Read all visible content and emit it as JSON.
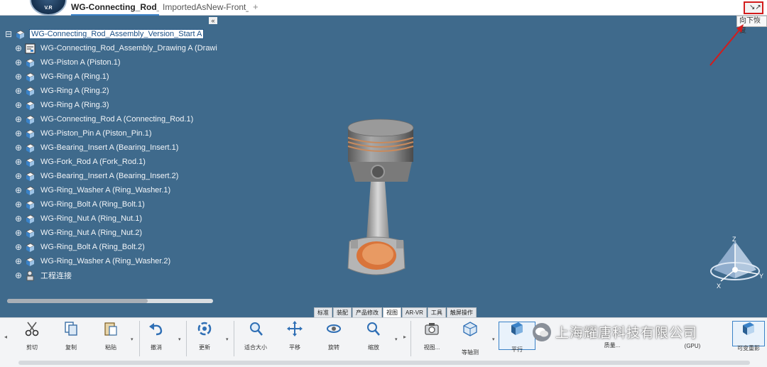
{
  "topbar": {
    "logo_text": "V.R",
    "active_tab": "WG-Connecting_Rod_As",
    "inactive_tab": "ImportedAsNew-Front_L",
    "plus": "+",
    "restore_glyph": "↘↗"
  },
  "tooltip": "向下恢复",
  "collapse": "«",
  "tree": {
    "root": "WG-Connecting_Rod_Assembly_Version_Start A",
    "items": [
      "WG-Connecting_Rod_Assembly_Drawing A (Drawing_l",
      "WG-Piston A (Piston.1)",
      "WG-Ring A (Ring.1)",
      "WG-Ring A (Ring.2)",
      "WG-Ring A (Ring.3)",
      "WG-Connecting_Rod A (Connecting_Rod.1)",
      "WG-Piston_Pin A (Piston_Pin.1)",
      "WG-Bearing_Insert A (Bearing_Insert.1)",
      "WG-Fork_Rod A (Fork_Rod.1)",
      "WG-Bearing_Insert A (Bearing_Insert.2)",
      "WG-Ring_Washer A (Ring_Washer.1)",
      "WG-Ring_Bolt A (Ring_Bolt.1)",
      "WG-Ring_Nut A (Ring_Nut.1)",
      "WG-Ring_Nut A (Ring_Nut.2)",
      "WG-Ring_Bolt A (Ring_Bolt.2)",
      "WG-Ring_Washer A (Ring_Washer.2)",
      "工程连接"
    ]
  },
  "ribbon": {
    "tabs": [
      "标准",
      "装配",
      "产品修改",
      "视图",
      "AR-VR",
      "工具",
      "触屏操作"
    ],
    "active_tab": "视图",
    "tools": {
      "cut": "剪切",
      "copy": "复制",
      "paste": "粘贴",
      "undo": "撤消",
      "update": "更新",
      "fit": "适合大小",
      "pan": "平移",
      "rotate": "旋转",
      "zoom": "缩放",
      "view": "视图...",
      "isometric": "等轴测",
      "parallel": "平行",
      "quality": "质量...",
      "gpu_line1": "(GPU)",
      "visibility": "可变重影"
    }
  },
  "watermark": "上海耀唐科技有限公司",
  "navcube": {
    "z": "Z",
    "x": "X",
    "y": "Y"
  },
  "colors": {
    "viewport_bg": "#3f6a8c",
    "accent": "#3a82c8",
    "highlight_red": "#d31c1c",
    "bearing_orange": "#d9743a"
  }
}
